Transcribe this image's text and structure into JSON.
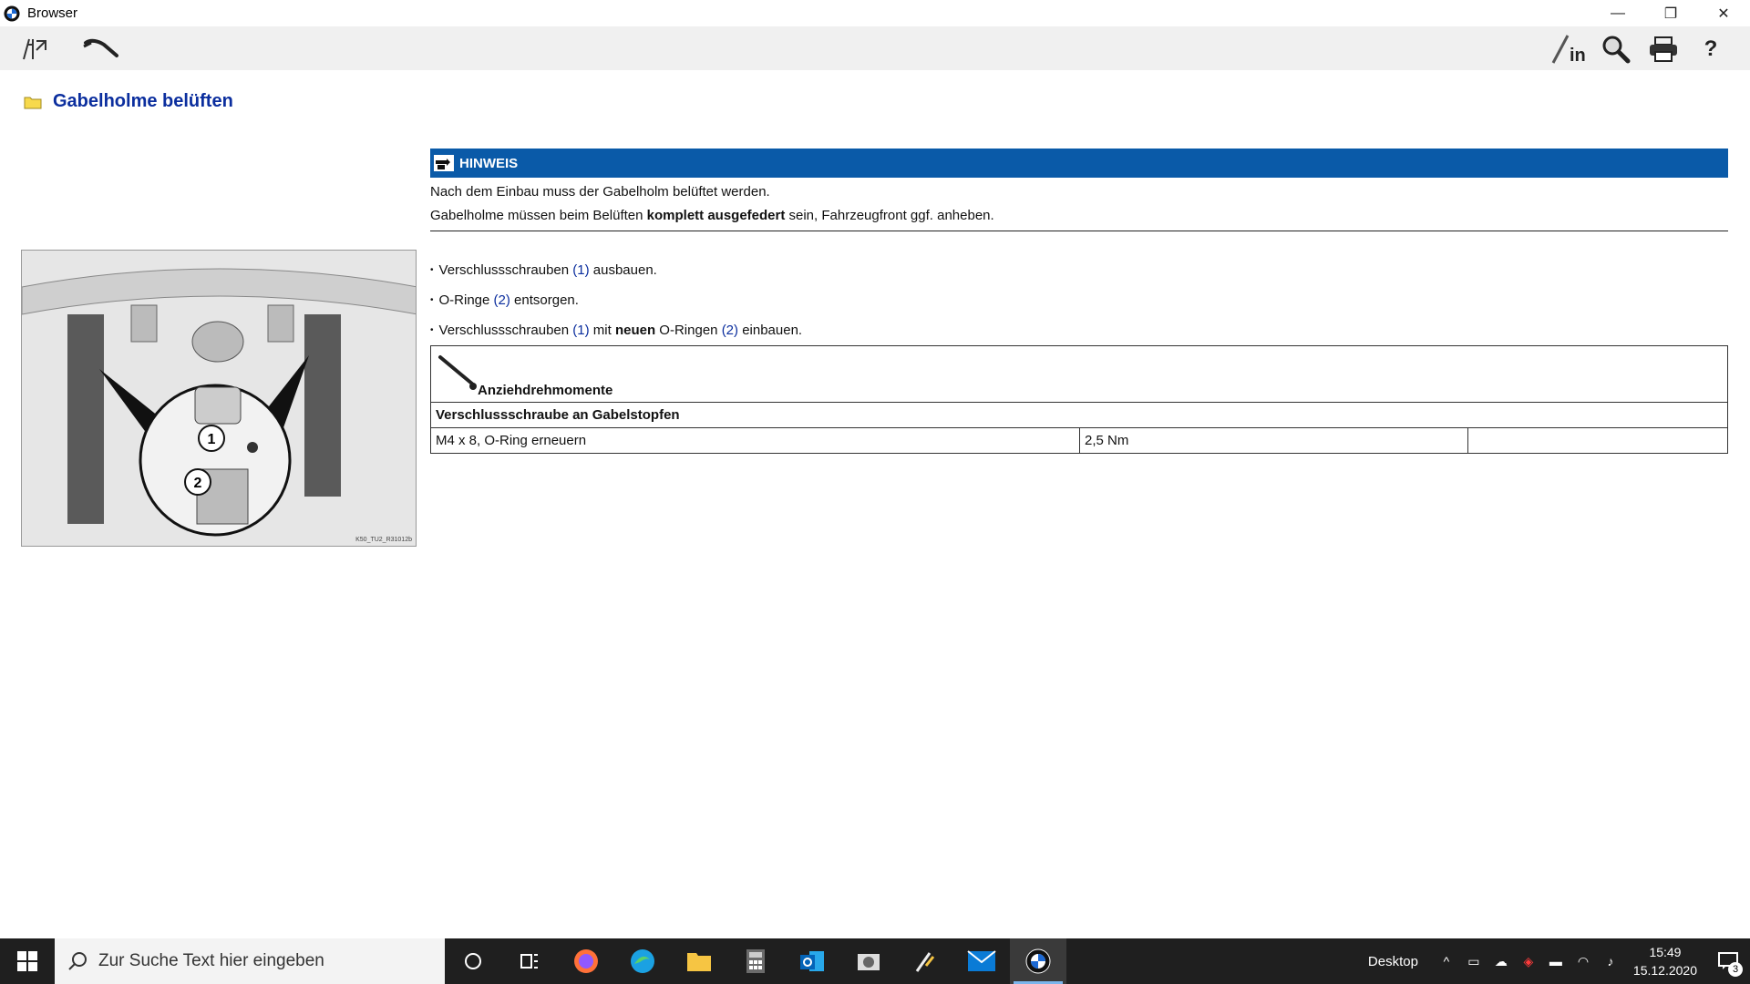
{
  "window": {
    "title": "Browser",
    "controls": {
      "minimize": "—",
      "restore": "❐",
      "close": "✕"
    }
  },
  "toolbar": {
    "left_icons": [
      "split-view-icon",
      "wrench-tool-icon"
    ],
    "right_icons": [
      "info-pen-icon",
      "search-icon",
      "print-icon",
      "help-icon"
    ],
    "help_label": "?"
  },
  "page": {
    "title": "Gabelholme belüften",
    "figure_code": "K50_TU2_R31012b",
    "figure_callouts": [
      "1",
      "2"
    ]
  },
  "hinweis": {
    "label": "HINWEIS",
    "line1": "Nach dem Einbau muss der Gabelholm belüftet werden.",
    "line2_pre": "Gabelholme müssen beim Belüften ",
    "line2_bold": "komplett ausgefedert",
    "line2_post": " sein, Fahrzeugfront ggf. anheben."
  },
  "steps": [
    {
      "pre": "Verschlussschrauben ",
      "ref": "(1)",
      "mid": " ausbauen.",
      "bold": "",
      "mid2": "",
      "ref2": "",
      "post": ""
    },
    {
      "pre": "O-Ringe ",
      "ref": "(2)",
      "mid": " entsorgen.",
      "bold": "",
      "mid2": "",
      "ref2": "",
      "post": ""
    },
    {
      "pre": "Verschlussschrauben ",
      "ref": "(1)",
      "mid": " mit ",
      "bold": "neuen",
      "mid2": " O-Ringen ",
      "ref2": "(2)",
      "post": " einbauen."
    }
  ],
  "torque": {
    "heading": "Anziehdrehmomente",
    "subheading": "Verschlussschraube an Gabelstopfen",
    "rows": [
      {
        "item": "M4 x 8, O-Ring erneuern",
        "value": "2,5 Nm",
        "note": ""
      }
    ]
  },
  "taskbar": {
    "search_placeholder": "Zur Suche Text hier eingeben",
    "apps": [
      "cortana-icon",
      "task-view-icon",
      "firefox-icon",
      "edge-icon",
      "file-explorer-icon",
      "calculator-icon",
      "outlook-icon",
      "app-icon",
      "tool-app-icon",
      "mail-icon",
      "bmw-icon"
    ],
    "desktop_label": "Desktop",
    "time": "15:49",
    "date": "15.12.2020",
    "notification_count": "3"
  },
  "colors": {
    "hinweis_bar": "#0a5aa8",
    "title_blue": "#0b2e9e",
    "taskbar": "#1f1f1f"
  }
}
